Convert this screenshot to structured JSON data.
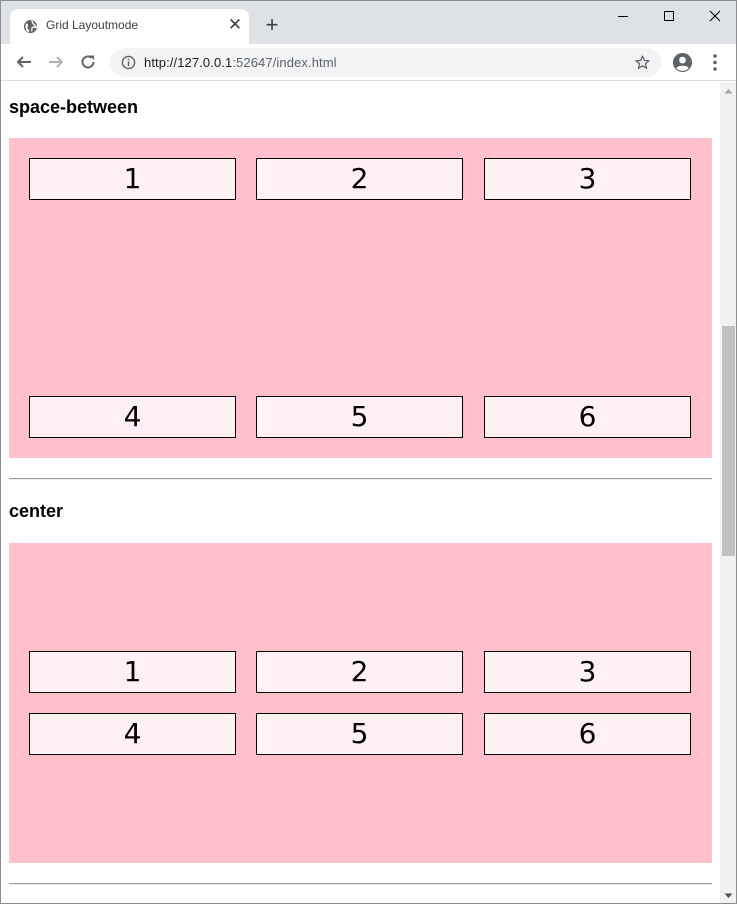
{
  "tab": {
    "title": "Grid Layoutmode",
    "close_glyph": "✕",
    "new_tab_glyph": "+"
  },
  "address": {
    "host": "http://127.0.0.1",
    "rest": ":52647/index.html"
  },
  "sections": [
    {
      "heading": "space-between",
      "items": [
        "1",
        "2",
        "3",
        "4",
        "5",
        "6"
      ]
    },
    {
      "heading": "center",
      "items": [
        "1",
        "2",
        "3",
        "4",
        "5",
        "6"
      ]
    }
  ],
  "colors": {
    "grid_background": "#ffc0cb",
    "item_background": "#fff0f3",
    "tabstrip": "#dee1e6"
  },
  "icons": [
    "globe-icon",
    "close-icon",
    "plus-icon",
    "minimize-icon",
    "maximize-icon",
    "window-close-icon",
    "back-arrow-icon",
    "forward-arrow-icon",
    "reload-icon",
    "info-icon",
    "star-icon",
    "profile-icon",
    "kebab-menu-icon"
  ]
}
